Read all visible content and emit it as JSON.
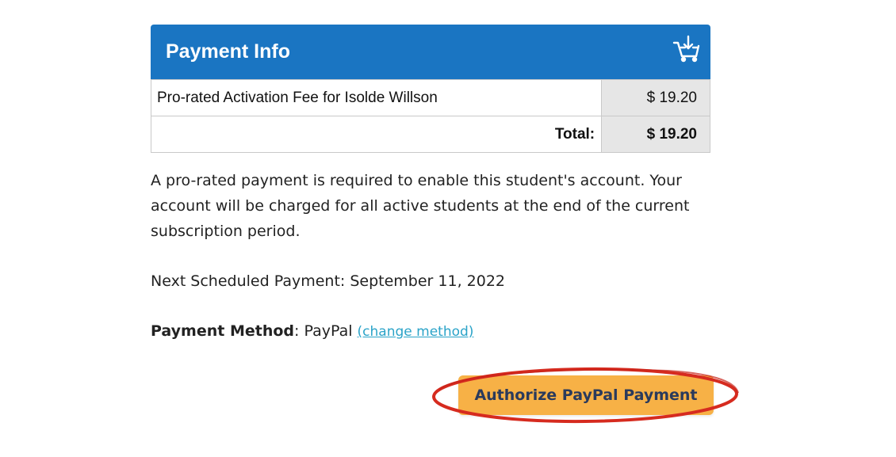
{
  "panel": {
    "title": "Payment Info",
    "icon": "cart-download-icon",
    "header_color": "#1a75c2"
  },
  "fees": {
    "items": [
      {
        "description": "Pro-rated Activation Fee for Isolde Willson",
        "amount": "$ 19.20"
      }
    ],
    "total_label": "Total:",
    "total_amount": "$ 19.20"
  },
  "notice": "A pro-rated payment is required to enable this student's account. Your account will be charged for all active students at the end of the current subscription period.",
  "next_payment": "Next Scheduled Payment: September 11, 2022",
  "payment_method": {
    "label": "Payment Method",
    "separator": ":",
    "value": "PayPal",
    "change_link": "(change method)"
  },
  "authorize_button": {
    "label": "Authorize PayPal Payment",
    "color": "#f7b146",
    "highlight_color": "#d62b1f"
  }
}
